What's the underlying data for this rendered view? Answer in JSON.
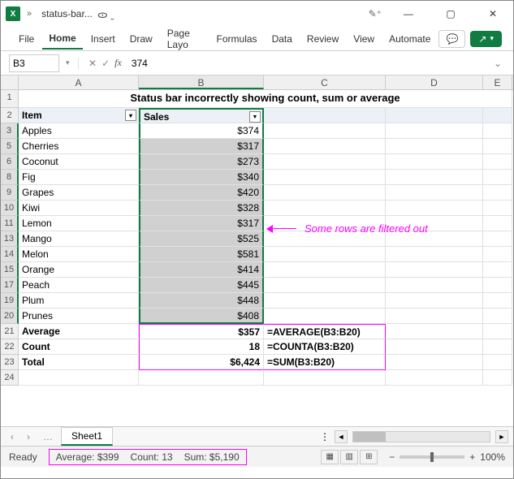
{
  "titlebar": {
    "app_icon": "X",
    "filename": "status-bar...",
    "minimize": "—",
    "maximize": "▢",
    "close": "✕"
  },
  "ribbon": {
    "tabs": [
      "File",
      "Home",
      "Insert",
      "Draw",
      "Page Layo",
      "Formulas",
      "Data",
      "Review",
      "View",
      "Automate"
    ],
    "active": "Home",
    "share": "↗"
  },
  "formula_bar": {
    "name_box": "B3",
    "cancel": "✕",
    "confirm": "✓",
    "fx": "fx",
    "value": "374"
  },
  "columns": [
    "A",
    "B",
    "C",
    "D",
    "E"
  ],
  "title_text": "Status bar incorrectly showing count, sum or average",
  "headers": {
    "A": "Item",
    "B": "Sales"
  },
  "rows": [
    {
      "n": 3,
      "item": "Apples",
      "sales": "$374"
    },
    {
      "n": 5,
      "item": "Cherries",
      "sales": "$317"
    },
    {
      "n": 6,
      "item": "Coconut",
      "sales": "$273"
    },
    {
      "n": 8,
      "item": "Fig",
      "sales": "$340"
    },
    {
      "n": 9,
      "item": "Grapes",
      "sales": "$420"
    },
    {
      "n": 10,
      "item": "Kiwi",
      "sales": "$328"
    },
    {
      "n": 11,
      "item": "Lemon",
      "sales": "$317"
    },
    {
      "n": 13,
      "item": "Mango",
      "sales": "$525"
    },
    {
      "n": 14,
      "item": "Melon",
      "sales": "$581"
    },
    {
      "n": 15,
      "item": "Orange",
      "sales": "$414"
    },
    {
      "n": 17,
      "item": "Peach",
      "sales": "$445"
    },
    {
      "n": 19,
      "item": "Plum",
      "sales": "$448"
    },
    {
      "n": 20,
      "item": "Prunes",
      "sales": "$408"
    }
  ],
  "summary": [
    {
      "n": 21,
      "label": "Average",
      "value": "$357",
      "formula": "=AVERAGE(B3:B20)"
    },
    {
      "n": 22,
      "label": "Count",
      "value": "18",
      "formula": "=COUNTA(B3:B20)"
    },
    {
      "n": 23,
      "label": "Total",
      "value": "$6,424",
      "formula": "=SUM(B3:B20)"
    }
  ],
  "empty_row": "24",
  "annotation": "Some rows are filtered out",
  "sheet": {
    "prev": "‹",
    "next": "›",
    "more": "…",
    "name": "Sheet1",
    "vdots": "⋮"
  },
  "status": {
    "ready": "Ready",
    "average": "Average: $399",
    "count": "Count: 13",
    "sum": "Sum: $5,190",
    "zoom": "100%",
    "minus": "−",
    "plus": "+"
  }
}
